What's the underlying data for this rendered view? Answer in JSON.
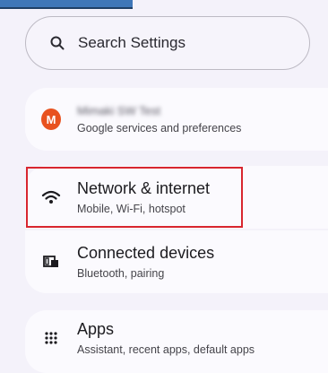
{
  "search": {
    "placeholder": "Search Settings",
    "icon": "search-icon"
  },
  "account": {
    "avatar_letter": "M",
    "avatar_color": "#e8521f",
    "name": "Mimaki SW Test",
    "subtitle": "Google services and preferences"
  },
  "items": [
    {
      "title": "Network & internet",
      "subtitle": "Mobile, Wi-Fi, hotspot",
      "icon": "wifi-icon"
    },
    {
      "title": "Connected devices",
      "subtitle": "Bluetooth, pairing",
      "icon": "devices-icon"
    },
    {
      "title": "Apps",
      "subtitle": "Assistant, recent apps, default apps",
      "icon": "apps-grid-icon"
    }
  ],
  "highlight_color": "#d8262f"
}
